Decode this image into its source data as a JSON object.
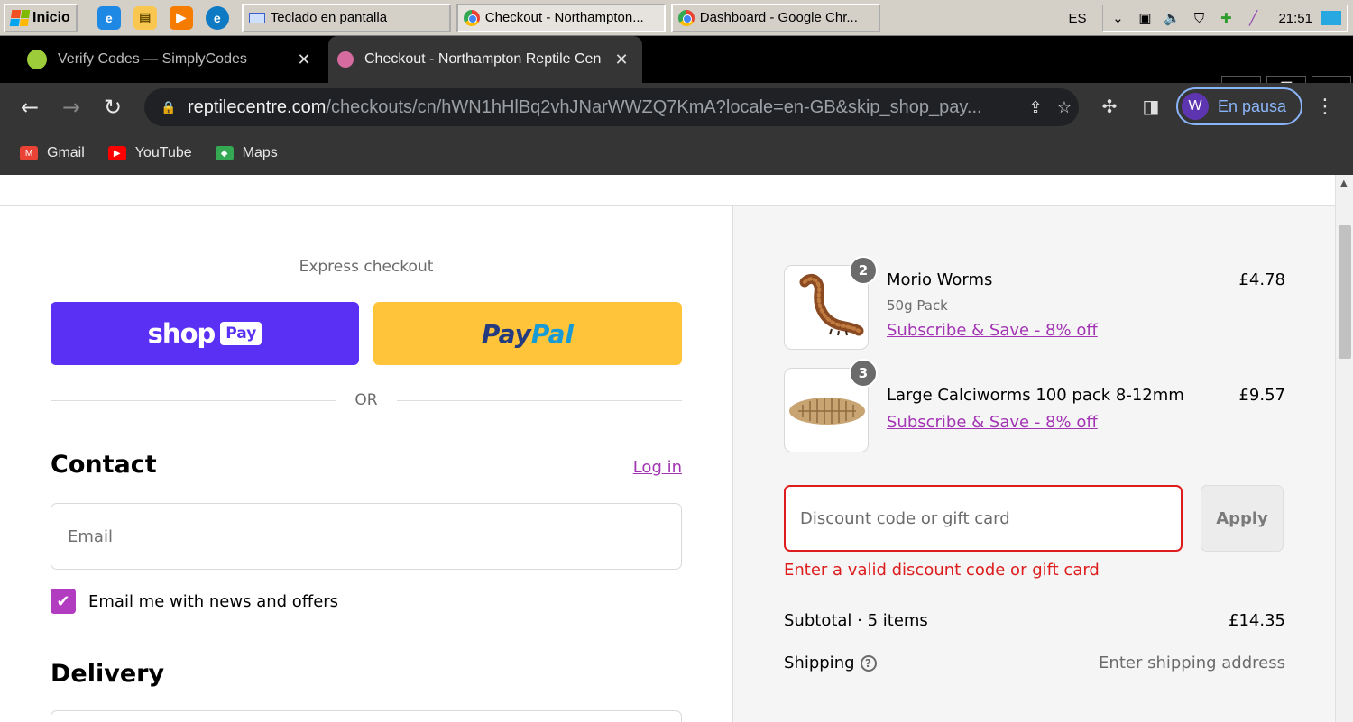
{
  "taskbar": {
    "start_label": "Inicio",
    "tasks": [
      {
        "label": "Teclado en pantalla"
      },
      {
        "label": "Checkout - Northampton..."
      },
      {
        "label": "Dashboard - Google Chr..."
      }
    ],
    "lang": "ES",
    "time": "21:51"
  },
  "tabs": [
    {
      "title": "Verify Codes — SimplyCodes"
    },
    {
      "title": "Checkout - Northampton Reptile Cen"
    }
  ],
  "omnibox": {
    "host": "reptilecentre.com",
    "path": "/checkouts/cn/hWN1hHlBq2vhJNarWWZQ7KmA?locale=en-GB&skip_shop_pay..."
  },
  "profile": {
    "initial": "W",
    "label": "En pausa"
  },
  "bookmarks": [
    {
      "label": "Gmail"
    },
    {
      "label": "YouTube"
    },
    {
      "label": "Maps"
    }
  ],
  "checkout": {
    "express_label": "Express checkout",
    "shoppay": {
      "shop": "shop",
      "pay": "Pay"
    },
    "paypal": {
      "p1": "Pay",
      "p2": "Pal"
    },
    "or_label": "OR",
    "contact_heading": "Contact",
    "login_label": "Log in",
    "email_placeholder": "Email",
    "newsletter_label": "Email me with news and offers",
    "newsletter_checked": true,
    "delivery_heading": "Delivery"
  },
  "summary": {
    "items": [
      {
        "qty": "2",
        "name": "Morio Worms",
        "variant": "50g Pack",
        "subscribe": "Subscribe & Save - 8% off",
        "price": "£4.78"
      },
      {
        "qty": "3",
        "name": "Large Calciworms 100 pack 8-12mm",
        "subscribe": "Subscribe & Save - 8% off",
        "price": "£9.57"
      }
    ],
    "discount_placeholder": "Discount code or gift card",
    "apply_label": "Apply",
    "error": "Enter a valid discount code or gift card",
    "subtotal_label": "Subtotal · 5 items",
    "subtotal_value": "£14.35",
    "shipping_label": "Shipping",
    "shipping_value": "Enter shipping address"
  },
  "colors": {
    "accent": "#a335b4",
    "shoppay": "#5a31f4",
    "paypal": "#ffc439",
    "error": "#dd1d1d"
  }
}
